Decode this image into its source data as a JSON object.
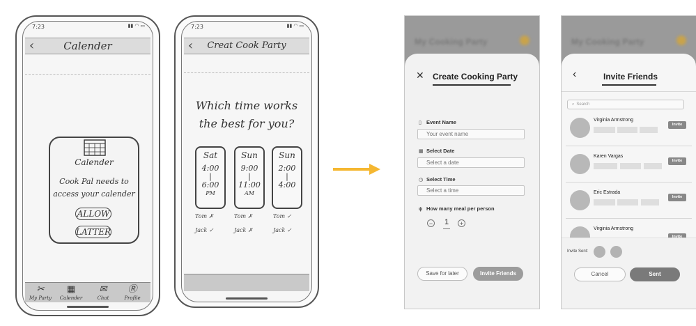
{
  "sketch1": {
    "status_time": "7:23",
    "header_title": "Calender",
    "modal_title": "Calender",
    "modal_text_line1": "Cook Pal needs to",
    "modal_text_line2": "access your calender",
    "allow_label": "ALLOW",
    "later_label": "LATTER",
    "tabs": [
      {
        "label": "My Party",
        "icon": "utensils-icon",
        "glyph": "✂"
      },
      {
        "label": "Calender",
        "icon": "calendar-icon",
        "glyph": "▦"
      },
      {
        "label": "Chat",
        "icon": "chat-icon",
        "glyph": "✉"
      },
      {
        "label": "Profile",
        "icon": "profile-icon",
        "glyph": "Ⓡ"
      }
    ]
  },
  "sketch2": {
    "status_time": "7:23",
    "header_title": "Creat Cook Party",
    "question_line1": "Which time works",
    "question_line2": "the best for you?",
    "options": [
      {
        "day": "Sat",
        "start": "4:00",
        "end": "6:00",
        "suffix": "PM"
      },
      {
        "day": "Sun",
        "start": "9:00",
        "end": "11:00",
        "suffix": "AM"
      },
      {
        "day": "Sun",
        "start": "2:00",
        "end": "4:00",
        "suffix": ""
      }
    ],
    "votes": [
      [
        "Tom ✗",
        "Tom ✗",
        "Tom ✓"
      ],
      [
        "Jack ✓",
        "Jack ✗",
        "Jack ✓"
      ]
    ]
  },
  "hifi1": {
    "bg_title": "My Cooking Party",
    "title": "Create Cooking Party",
    "fields": [
      {
        "label": "Event Name",
        "placeholder": "Your event name",
        "icon": "bookmark-icon",
        "glyph": "▯"
      },
      {
        "label": "Select Date",
        "placeholder": "Select a date",
        "icon": "calendar-icon",
        "glyph": "▦"
      },
      {
        "label": "Select Time",
        "placeholder": "Select a time",
        "icon": "clock-icon",
        "glyph": "◷"
      }
    ],
    "meal_label": "How many meal per person",
    "meal_value": "1",
    "save_label": "Save for later",
    "invite_label": "Invite Friends"
  },
  "hifi2": {
    "bg_title": "My Cooking Party",
    "title": "Invite Friends",
    "search_placeholder": "Search",
    "friends": [
      {
        "name": "Virginia Armstrong",
        "invite": "Invite"
      },
      {
        "name": "Karen Vargas",
        "invite": "Invite"
      },
      {
        "name": "Eric Estrada",
        "invite": "Invite"
      },
      {
        "name": "Virginia Armstrong",
        "invite": "Invite"
      }
    ],
    "invite_sent_label": "Invite Sent:",
    "cancel_label": "Cancel",
    "sent_label": "Sent"
  }
}
